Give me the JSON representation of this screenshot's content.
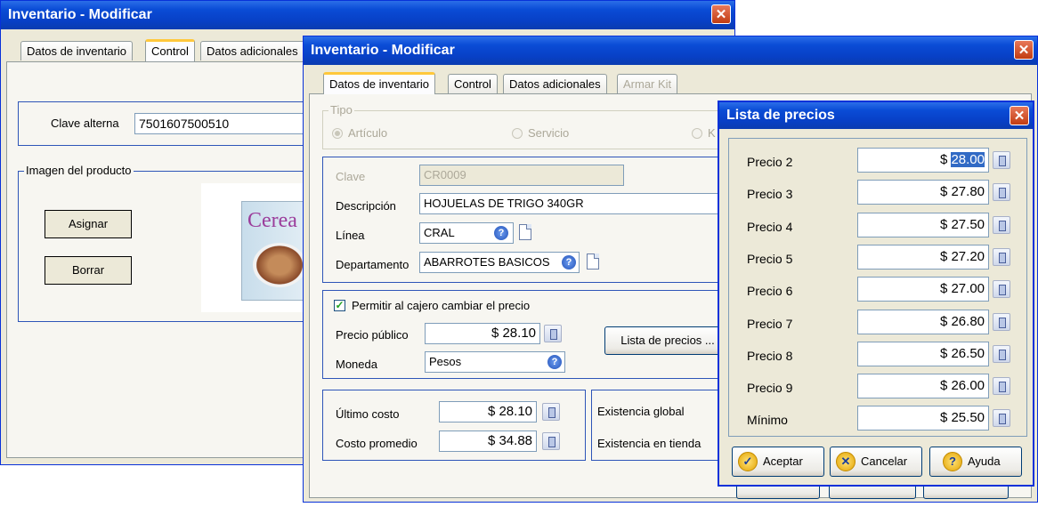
{
  "window1": {
    "title": "Inventario - Modificar",
    "close": "✕",
    "tabs": [
      "Datos de inventario",
      "Control",
      "Datos adicionales"
    ],
    "clave_alterna": {
      "label": "Clave alterna",
      "value": "7501607500510"
    },
    "imagen_group": "Imagen del producto",
    "asignar": "Asignar",
    "borrar": "Borrar",
    "product_image_text": "Cerea"
  },
  "window2": {
    "title": "Inventario - Modificar",
    "close": "✕",
    "tabs": [
      "Datos de inventario",
      "Control",
      "Datos adicionales",
      "Armar Kit"
    ],
    "tipo": {
      "label": "Tipo",
      "options": [
        "Artículo",
        "Servicio",
        "K"
      ],
      "selected": "Artículo"
    },
    "clave": {
      "label": "Clave",
      "value": "CR0009"
    },
    "descripcion": {
      "label": "Descripción",
      "value": "HOJUELAS DE TRIGO 340GR"
    },
    "linea": {
      "label": "Línea",
      "value": "CRAL"
    },
    "departamento": {
      "label": "Departamento",
      "value": "ABARROTES BASICOS"
    },
    "permitir": {
      "label": "Permitir al cajero cambiar el precio",
      "checked": true
    },
    "precio_publico": {
      "label": "Precio público",
      "value": "$ 28.10"
    },
    "moneda": {
      "label": "Moneda",
      "value": "Pesos"
    },
    "lista_btn": "Lista de precios ...",
    "ultimo_costo": {
      "label": "Último costo",
      "value": "$ 28.10"
    },
    "costo_promedio": {
      "label": "Costo promedio",
      "value": "$ 34.88"
    },
    "existencia_global": "Existencia global",
    "existencia_tienda": "Existencia  en tienda"
  },
  "dialog": {
    "title": "Lista de precios",
    "close": "✕",
    "precios": [
      {
        "label": "Precio 2",
        "value": "28.00",
        "prefix": "$ "
      },
      {
        "label": "Precio 3",
        "value": "$ 27.80"
      },
      {
        "label": "Precio 4",
        "value": "$ 27.50"
      },
      {
        "label": "Precio 5",
        "value": "$ 27.20"
      },
      {
        "label": "Precio 6",
        "value": "$ 27.00"
      },
      {
        "label": "Precio 7",
        "value": "$ 26.80"
      },
      {
        "label": "Precio 8",
        "value": "$ 26.50"
      },
      {
        "label": "Precio 9",
        "value": "$ 26.00"
      },
      {
        "label": "Mínimo",
        "value": "$ 25.50"
      }
    ],
    "aceptar": "Aceptar",
    "cancelar": "Cancelar",
    "ayuda": "Ayuda"
  }
}
